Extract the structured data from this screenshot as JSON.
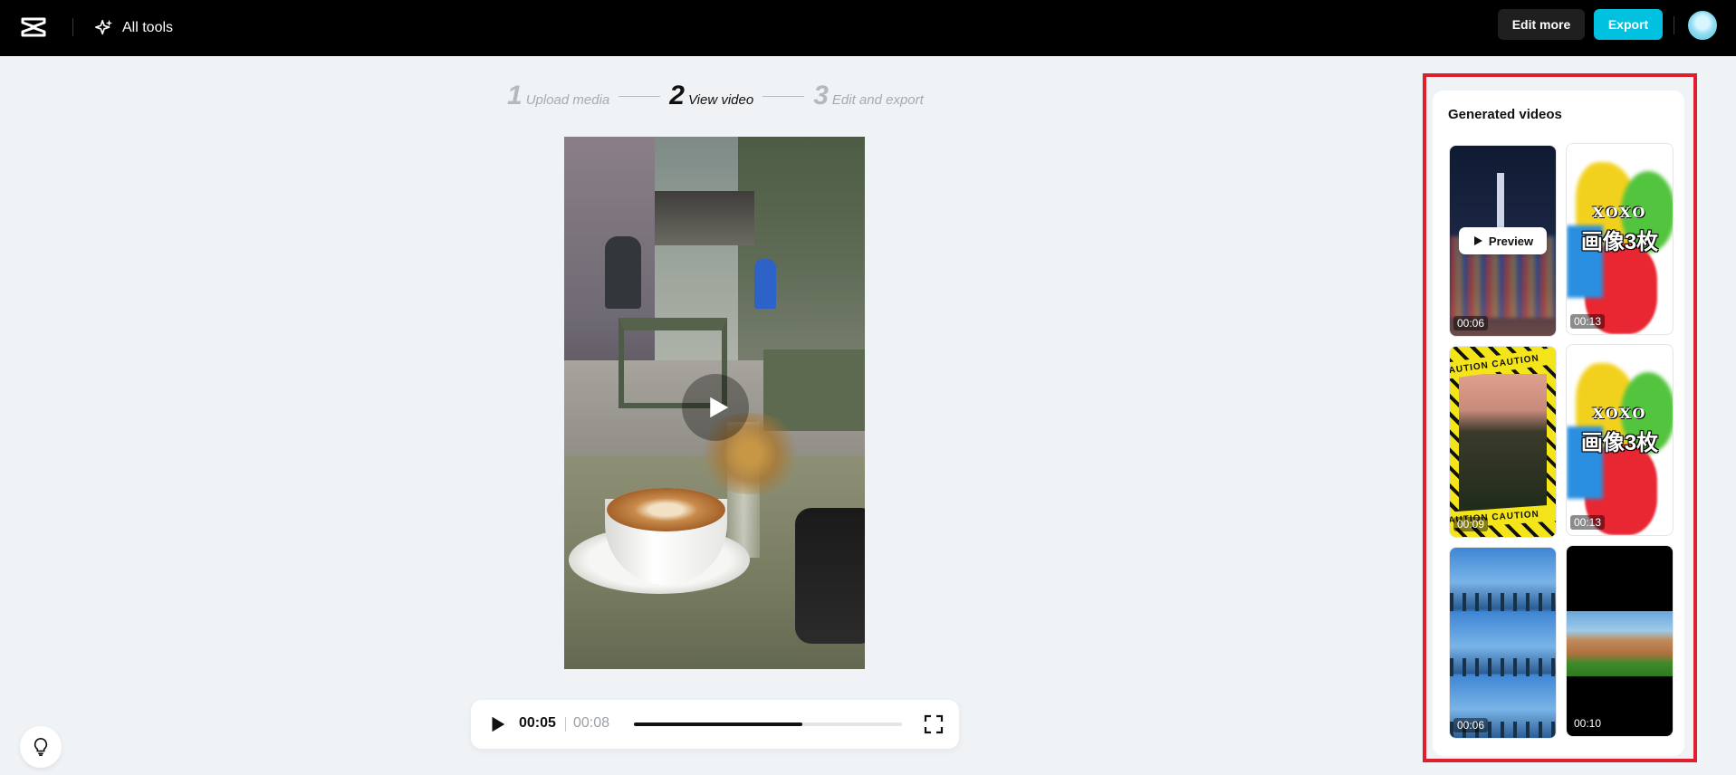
{
  "header": {
    "all_tools_label": "All tools",
    "edit_more_label": "Edit more",
    "export_label": "Export"
  },
  "stepper": {
    "steps": [
      {
        "number": "1",
        "label": "Upload media",
        "active": false
      },
      {
        "number": "2",
        "label": "View video",
        "active": true
      },
      {
        "number": "3",
        "label": "Edit and export",
        "active": false
      }
    ]
  },
  "player": {
    "current_time": "00:05",
    "total_time": "00:08",
    "progress_fraction": 0.63
  },
  "generated": {
    "title": "Generated videos",
    "preview_label": "Preview",
    "videos": [
      {
        "duration": "00:06"
      },
      {
        "duration": "00:13",
        "overlay_text": "画像3枚",
        "badge_text": "XOXO"
      },
      {
        "duration": "00:09",
        "band_text": "CAUTION CAUTION"
      },
      {
        "duration": "00:13",
        "overlay_text": "画像3枚",
        "badge_text": "XOXO"
      },
      {
        "duration": "00:06"
      },
      {
        "duration": "00:10"
      }
    ]
  },
  "colors": {
    "accent": "#00c1e0",
    "highlight_frame": "#e11e2c"
  }
}
